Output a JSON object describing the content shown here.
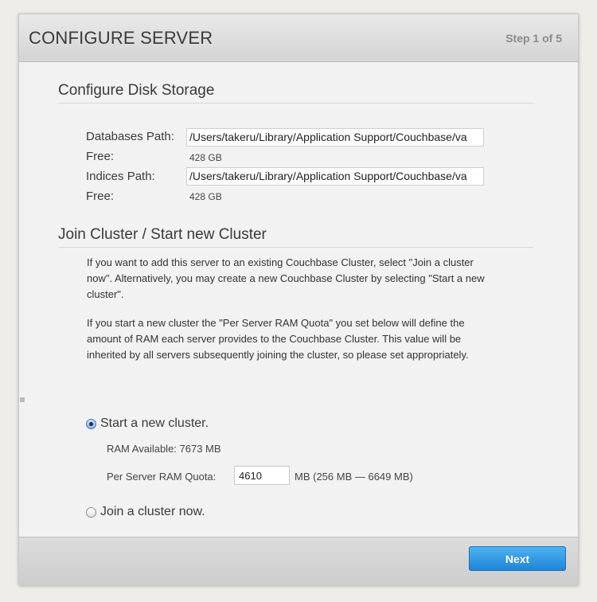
{
  "header": {
    "title": "CONFIGURE SERVER",
    "step": "Step 1 of 5"
  },
  "disk": {
    "title": "Configure Disk Storage",
    "db_path_label": "Databases Path:",
    "db_path_value": "/Users/takeru/Library/Application Support/Couchbase/va",
    "db_free_label": "Free:",
    "db_free_value": "428 GB",
    "idx_path_label": "Indices Path:",
    "idx_path_value": "/Users/takeru/Library/Application Support/Couchbase/va",
    "idx_free_label": "Free:",
    "idx_free_value": "428 GB"
  },
  "cluster": {
    "title": "Join Cluster / Start new Cluster",
    "para1": "If you want to add this server to an existing Couchbase Cluster, select \"Join a cluster now\". Alternatively, you may create a new Couchbase Cluster by selecting \"Start a new cluster\".",
    "para2": "If you start a new cluster the \"Per Server RAM Quota\" you set below will define the amount of RAM each server provides to the Couchbase Cluster. This value will be inherited by all servers subsequently joining the cluster, so please set appropriately.",
    "start_label": "Start a new cluster.",
    "ram_available": "RAM Available: 7673 MB",
    "quota_label": "Per Server RAM Quota:",
    "quota_value": "4610",
    "quota_range": "MB (256 MB — 6649 MB)",
    "join_label": "Join a cluster now."
  },
  "footer": {
    "next_label": "Next"
  }
}
